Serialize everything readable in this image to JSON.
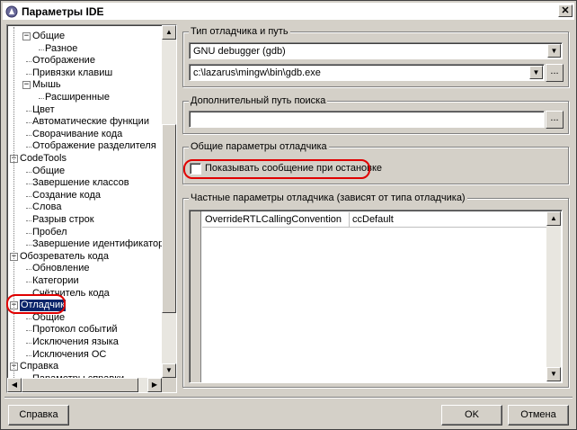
{
  "window": {
    "title": "Параметры IDE",
    "close_glyph": "✕"
  },
  "tree": {
    "items": [
      {
        "label": "Общие",
        "level": 1,
        "expander": "−"
      },
      {
        "label": "Разное",
        "level": 2
      },
      {
        "label": "Отображение",
        "level": 1
      },
      {
        "label": "Привязки клавиш",
        "level": 1
      },
      {
        "label": "Мышь",
        "level": 1,
        "expander": "−"
      },
      {
        "label": "Расширенные",
        "level": 2
      },
      {
        "label": "Цвет",
        "level": 1
      },
      {
        "label": "Автоматические функции",
        "level": 1
      },
      {
        "label": "Сворачивание кода",
        "level": 1
      },
      {
        "label": "Отображение разделителя",
        "level": 1
      },
      {
        "label": "CodeTools",
        "level": 0,
        "expander": "−"
      },
      {
        "label": "Общие",
        "level": 1
      },
      {
        "label": "Завершение классов",
        "level": 1
      },
      {
        "label": "Создание кода",
        "level": 1
      },
      {
        "label": "Слова",
        "level": 1
      },
      {
        "label": "Разрыв строк",
        "level": 1
      },
      {
        "label": "Пробел",
        "level": 1
      },
      {
        "label": "Завершение идентификаторов",
        "level": 1
      },
      {
        "label": "Обозреватель кода",
        "level": 0,
        "expander": "−"
      },
      {
        "label": "Обновление",
        "level": 1
      },
      {
        "label": "Категории",
        "level": 1
      },
      {
        "label": "Счётчитель кода",
        "level": 1
      },
      {
        "label": "Отладчик",
        "level": 0,
        "expander": "−",
        "selected": true
      },
      {
        "label": "Общие",
        "level": 1
      },
      {
        "label": "Протокол событий",
        "level": 1
      },
      {
        "label": "Исключения языка",
        "level": 1
      },
      {
        "label": "Исключения ОС",
        "level": 1
      },
      {
        "label": "Справка",
        "level": 0,
        "expander": "−"
      },
      {
        "label": "Параметры справки",
        "level": 1
      }
    ]
  },
  "debugger_type": {
    "group_title": "Тип отладчика и путь",
    "type_value": "GNU debugger (gdb)",
    "path_value": "c:\\lazarus\\mingw\\bin\\gdb.exe",
    "browse_label": "..."
  },
  "search_path": {
    "group_title": "Дополнительный путь поиска",
    "value": "",
    "browse_label": "..."
  },
  "general": {
    "group_title": "Общие параметры отладчика",
    "show_message_label": "Показывать сообщение при остановке",
    "show_message_checked": false
  },
  "specific": {
    "group_title": "Частные параметры отладчика (зависят от типа отладчика)",
    "rows": [
      {
        "name": "OverrideRTLCallingConvention",
        "value": "ccDefault"
      }
    ]
  },
  "footer": {
    "help_label": "Справка",
    "ok_label": "OK",
    "cancel_label": "Отмена"
  },
  "colors": {
    "selection": "#0a246a",
    "annotation": "#e00000"
  },
  "icons": {
    "up": "▲",
    "down": "▼",
    "left": "◀",
    "right": "▶"
  }
}
